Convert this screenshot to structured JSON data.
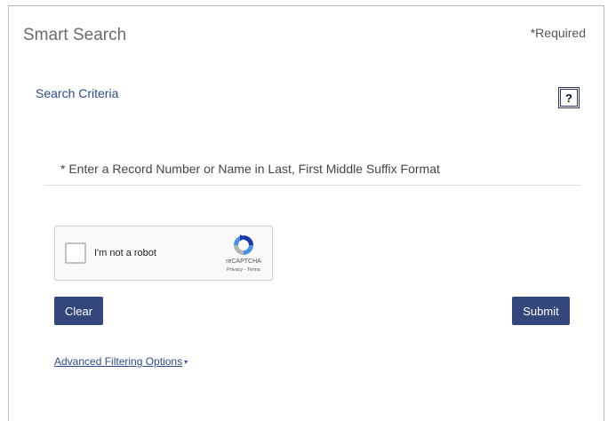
{
  "header": {
    "title": "Smart Search",
    "required_note": "*Required"
  },
  "criteria": {
    "heading": "Search Criteria",
    "help_label": "?"
  },
  "search": {
    "value": "",
    "placeholder": "* Enter a Record Number or Name in Last, First Middle Suffix Format"
  },
  "captcha": {
    "label": "I'm not a robot",
    "checked": false,
    "brand": "reCAPTCHA",
    "links": "Privacy - Terms",
    "icon": "recaptcha-logo-icon"
  },
  "actions": {
    "clear_label": "Clear",
    "submit_label": "Submit"
  },
  "advanced": {
    "label": "Advanced Filtering Options",
    "icon": "caret-down-icon"
  },
  "colors": {
    "primary_button": "#34477d",
    "link": "#2e4a8a",
    "title_text": "#6b6b6b"
  }
}
